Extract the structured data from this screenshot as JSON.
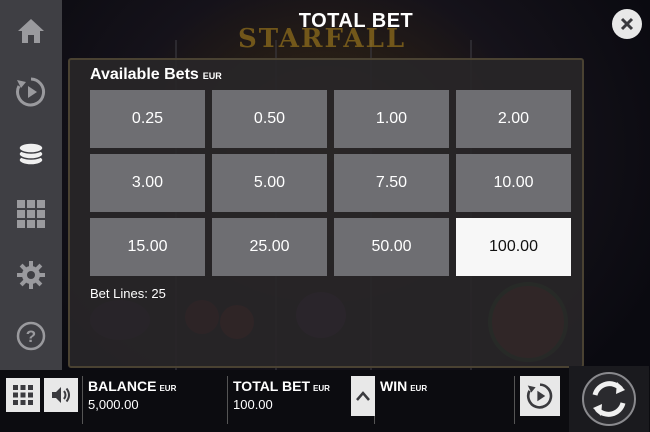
{
  "header": {
    "title": "TOTAL BET",
    "logo_text": "STARFALL"
  },
  "sidebar": {
    "items": [
      {
        "icon": "home-icon"
      },
      {
        "icon": "autoplay-icon"
      },
      {
        "icon": "coins-stack-icon"
      },
      {
        "icon": "grid-icon"
      },
      {
        "icon": "gear-icon"
      },
      {
        "icon": "help-icon"
      }
    ]
  },
  "bet_panel": {
    "heading": "Available Bets",
    "currency": "EUR",
    "options": [
      "0.25",
      "0.50",
      "1.00",
      "2.00",
      "3.00",
      "5.00",
      "7.50",
      "10.00",
      "15.00",
      "25.00",
      "50.00",
      "100.00"
    ],
    "selected": "100.00",
    "bet_lines": "Bet Lines: 25"
  },
  "bottom": {
    "balance_label": "BALANCE",
    "balance_currency": "EUR",
    "balance_value": "5,000.00",
    "total_bet_label": "TOTAL BET",
    "total_bet_currency": "EUR",
    "total_bet_value": "100.00",
    "win_label": "WIN",
    "win_currency": "EUR"
  },
  "colors": {
    "panel_bg": "#2a282a",
    "button_bg": "#6e6e72",
    "selected_bg": "#f7f7f7",
    "sidebar_bg": "#3f3f44"
  }
}
